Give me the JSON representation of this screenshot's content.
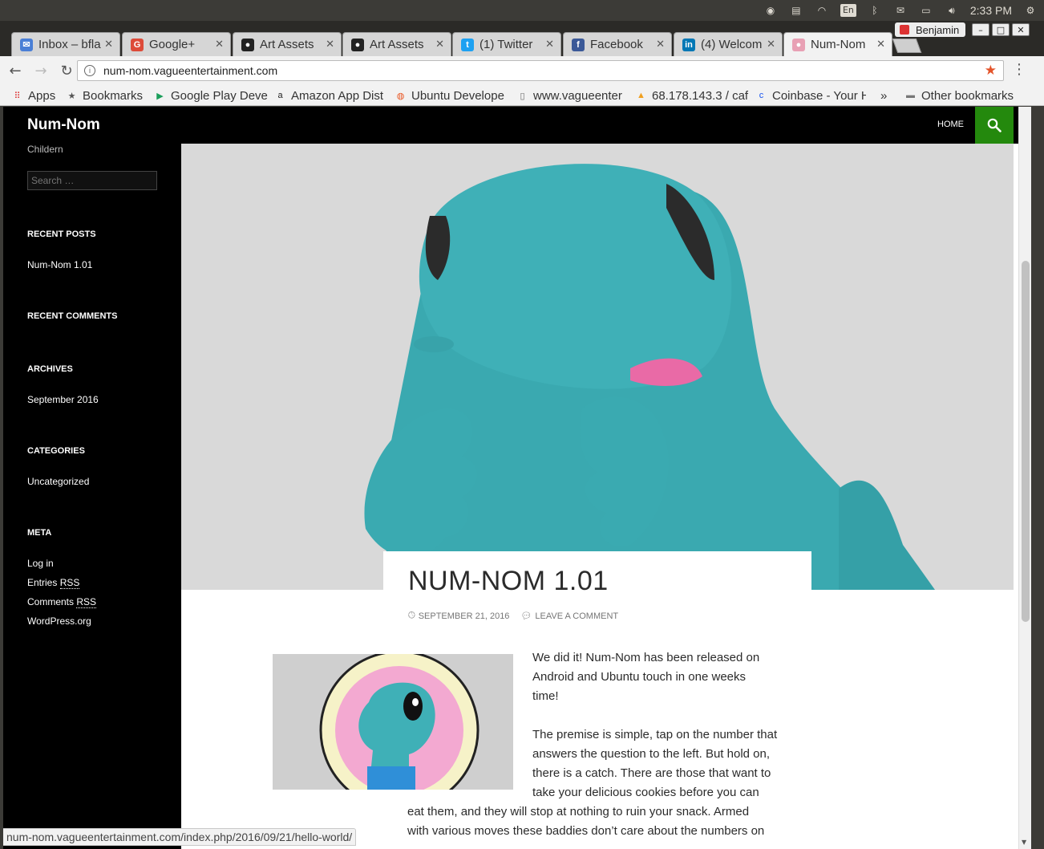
{
  "os_panel": {
    "language": "En",
    "clock": "2:33 PM"
  },
  "browser": {
    "profile_name": "Benjamin",
    "tabs": [
      {
        "label": "Inbox – bfla",
        "icon": "gmail-inbox-icon",
        "color": "#4a7fd6"
      },
      {
        "label": "Google+",
        "icon": "google-plus-icon",
        "color": "#dd4b39"
      },
      {
        "label": "Art Assets",
        "icon": "github-icon",
        "color": "#222222"
      },
      {
        "label": "Art Assets",
        "icon": "github-icon",
        "color": "#222222"
      },
      {
        "label": "(1) Twitter",
        "icon": "twitter-icon",
        "color": "#1da1f2"
      },
      {
        "label": "Facebook",
        "icon": "facebook-icon",
        "color": "#3b5998"
      },
      {
        "label": "(4) Welcom",
        "icon": "linkedin-icon",
        "color": "#0077b5"
      },
      {
        "label": "Num-Nom",
        "icon": "site-favicon",
        "color": "#e8a0b4"
      }
    ],
    "url": "num-nom.vagueentertainment.com",
    "bookmarks": [
      {
        "label": "Apps",
        "icon": "apps-grid-icon"
      },
      {
        "label": "Bookmarks",
        "icon": "star-icon"
      },
      {
        "label": "Google Play Deve",
        "icon": "google-play-icon"
      },
      {
        "label": "Amazon App Dist",
        "icon": "amazon-icon"
      },
      {
        "label": "Ubuntu Develope",
        "icon": "ubuntu-icon"
      },
      {
        "label": "www.vagueenter",
        "icon": "page-icon"
      },
      {
        "label": "68.178.143.3 / caf",
        "icon": "phpmyadmin-icon"
      },
      {
        "label": "Coinbase - Your H",
        "icon": "coinbase-icon"
      },
      {
        "label": "»",
        "icon": ""
      },
      {
        "label": "Other bookmarks",
        "icon": "folder-icon"
      }
    ],
    "status_url": "num-nom.vagueentertainment.com/index.php/2016/09/21/hello-world/"
  },
  "site": {
    "title": "Num-Nom",
    "tagline": "Childern",
    "nav_home": "HOME",
    "search_placeholder": "Search …",
    "accent": "#24890d",
    "widgets": {
      "recent_posts_title": "RECENT POSTS",
      "recent_posts": [
        "Num-Nom 1.01"
      ],
      "recent_comments_title": "RECENT COMMENTS",
      "archives_title": "ARCHIVES",
      "archives": [
        "September 2016"
      ],
      "categories_title": "CATEGORIES",
      "categories": [
        "Uncategorized"
      ],
      "meta_title": "META",
      "meta_login": "Log in",
      "meta_entries_prefix": "Entries ",
      "meta_comments_prefix": "Comments ",
      "meta_rss": "RSS",
      "meta_wordpress": "WordPress.org"
    }
  },
  "post": {
    "title": "NUM-NOM 1.01",
    "date": "SEPTEMBER 21, 2016",
    "leave_comment": "LEAVE A COMMENT",
    "para1_lines": [
      "We did it! Num-Nom has been released on",
      "Android and Ubuntu touch in one weeks",
      "time!"
    ],
    "para2_lines": [
      "The premise is simple, tap on the number that",
      "answers the question to the left. But hold on,",
      "there is a catch. There are those that want to",
      "take your delicious cookies before you can"
    ],
    "para2_wide_lines": [
      "eat them, and they will stop at nothing to ruin your snack. Armed",
      "with various moves these baddies don’t care about the numbers on"
    ]
  }
}
